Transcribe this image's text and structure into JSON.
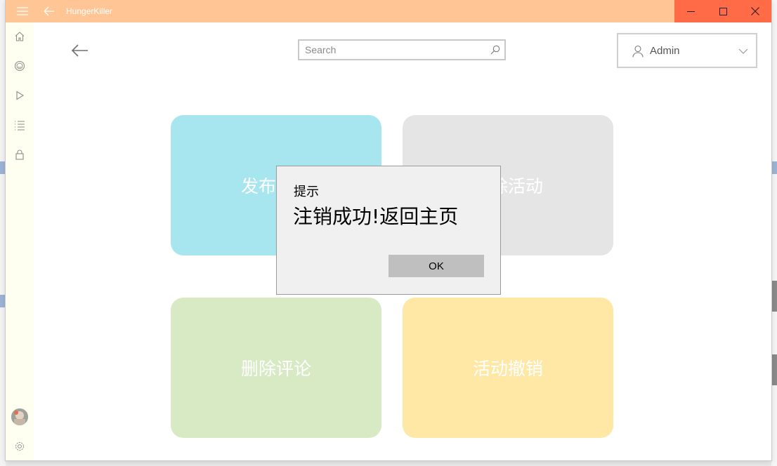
{
  "window": {
    "title": "HungerKiller",
    "titlebar_color": "#ffc594",
    "close_color": "#ff6a47"
  },
  "sidebar": {
    "items": [
      {
        "icon": "home-icon"
      },
      {
        "icon": "smiley-icon"
      },
      {
        "icon": "play-icon"
      },
      {
        "icon": "list-icon"
      },
      {
        "icon": "lock-icon"
      }
    ],
    "bottom": [
      {
        "icon": "avatar"
      },
      {
        "icon": "gear-icon"
      }
    ]
  },
  "header": {
    "search": {
      "placeholder": "Search",
      "value": ""
    },
    "user": {
      "name": "Admin"
    }
  },
  "tiles": [
    {
      "label": "发布活动",
      "color": "#a7e6ef"
    },
    {
      "label": "删除活动",
      "color": "#e5e5e5"
    },
    {
      "label": "删除评论",
      "color": "#d7eac4"
    },
    {
      "label": "活动撤销",
      "color": "#ffe8a6"
    }
  ],
  "dialog": {
    "title": "提示",
    "message": "注销成功!返回主页",
    "ok_label": "OK"
  }
}
